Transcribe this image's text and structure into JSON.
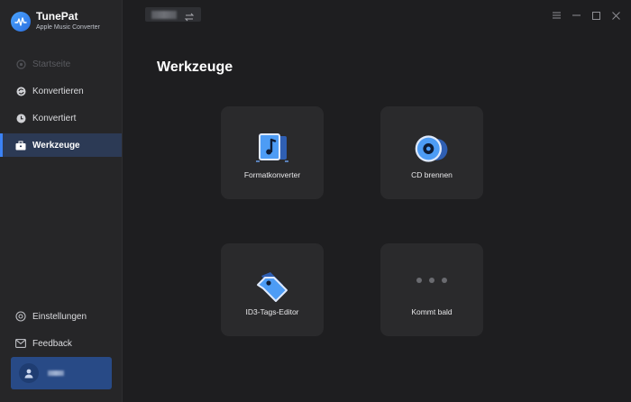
{
  "app": {
    "name": "TunePat",
    "subtitle": "Apple Music Converter"
  },
  "sidebar": {
    "items": [
      {
        "label": "Startseite",
        "icon": "home-icon",
        "state": "disabled"
      },
      {
        "label": "Konvertieren",
        "icon": "convert-icon",
        "state": "normal"
      },
      {
        "label": "Konvertiert",
        "icon": "clock-icon",
        "state": "normal"
      },
      {
        "label": "Werkzeuge",
        "icon": "toolbox-icon",
        "state": "active"
      }
    ],
    "bottom_items": [
      {
        "label": "Einstellungen",
        "icon": "gear-icon"
      },
      {
        "label": "Feedback",
        "icon": "mail-icon"
      }
    ]
  },
  "main": {
    "title": "Werkzeuge",
    "tools": [
      {
        "label": "Formatkonverter",
        "icon": "music-file-icon"
      },
      {
        "label": "CD brennen",
        "icon": "cd-icon"
      },
      {
        "label": "ID3-Tags-Editor",
        "icon": "tag-icon"
      },
      {
        "label": "Kommt bald",
        "icon": "more-dots-icon"
      }
    ]
  },
  "colors": {
    "accent": "#3b82f6",
    "background": "#1e1e20",
    "sidebar": "#262628",
    "tile": "#2a2a2c",
    "user_card": "#284a86"
  }
}
